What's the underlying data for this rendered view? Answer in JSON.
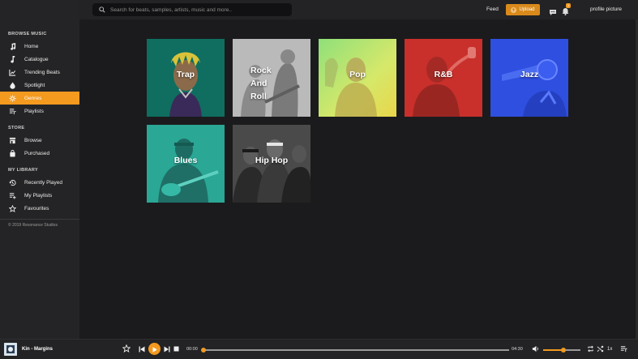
{
  "search": {
    "placeholder": "Search for beats, samples, artists, music and more.."
  },
  "topbar": {
    "feed_label": "Feed",
    "upload_label": "Upload",
    "notification_count": "1",
    "profile_label": "profile picture"
  },
  "sidebar": {
    "browse_title": "BROWSE MUSIC",
    "browse_items": [
      {
        "label": "Home",
        "icon": "music-note-icon"
      },
      {
        "label": "Catalogue",
        "icon": "note-icon"
      },
      {
        "label": "Trending Beats",
        "icon": "chart-icon"
      },
      {
        "label": "Spotlight",
        "icon": "flame-icon"
      },
      {
        "label": "Genres",
        "icon": "genres-icon",
        "active": true
      },
      {
        "label": "Playlists",
        "icon": "playlist-icon"
      }
    ],
    "store_title": "STORE",
    "store_items": [
      {
        "label": "Browse",
        "icon": "store-icon"
      },
      {
        "label": "Purchased",
        "icon": "bag-icon"
      }
    ],
    "library_title": "MY LIBRARY",
    "library_items": [
      {
        "label": "Recently Played",
        "icon": "history-icon"
      },
      {
        "label": "My Playlists",
        "icon": "playlist-add-icon"
      },
      {
        "label": "Favourites",
        "icon": "star-icon"
      }
    ],
    "copyright": "© 2019 Resonance Studios"
  },
  "genres": [
    {
      "name": "Trap",
      "tint": "#0f6e5f"
    },
    {
      "name": "Rock And Roll",
      "tint": "#cfcfcf"
    },
    {
      "name": "Pop",
      "tint": "#c7e85a"
    },
    {
      "name": "R&B",
      "tint": "#c9302b"
    },
    {
      "name": "Jazz",
      "tint": "#2e4fe0"
    },
    {
      "name": "Blues",
      "tint": "#2aa795"
    },
    {
      "name": "Hip Hop",
      "tint": "#4a4a4a"
    }
  ],
  "player": {
    "track": "Kin - Margins",
    "time_current": "00:00",
    "time_total": "04:30",
    "progress": 0,
    "volume": 0.55,
    "speed": "1x"
  },
  "colors": {
    "accent": "#f39a1f",
    "sidebar_bg": "#242426",
    "main_bg": "#1b1b1d"
  }
}
